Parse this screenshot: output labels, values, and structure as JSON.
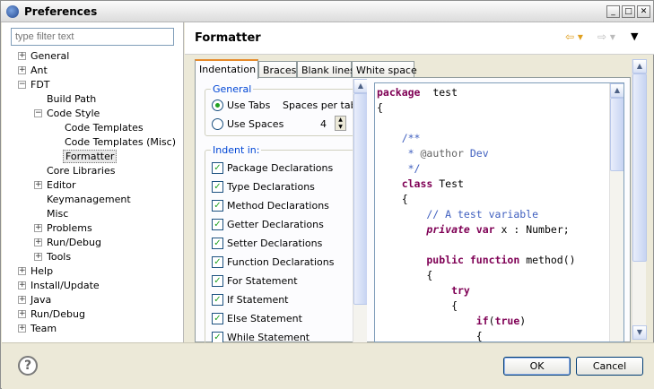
{
  "window": {
    "title": "Preferences",
    "buttons": [
      "_",
      "□",
      "✕"
    ]
  },
  "filter": {
    "placeholder": "type filter text"
  },
  "tree": [
    {
      "label": "General",
      "level": 0,
      "expander": "+"
    },
    {
      "label": "Ant",
      "level": 0,
      "expander": "+"
    },
    {
      "label": "FDT",
      "level": 0,
      "expander": "−"
    },
    {
      "label": "Build Path",
      "level": 1,
      "expander": ""
    },
    {
      "label": "Code Style",
      "level": 1,
      "expander": "−"
    },
    {
      "label": "Code Templates",
      "level": 2,
      "expander": ""
    },
    {
      "label": "Code Templates (Misc)",
      "level": 2,
      "expander": ""
    },
    {
      "label": "Formatter",
      "level": 2,
      "expander": "",
      "selected": true
    },
    {
      "label": "Core Libraries",
      "level": 1,
      "expander": ""
    },
    {
      "label": "Editor",
      "level": 1,
      "expander": "+"
    },
    {
      "label": "Keymanagement",
      "level": 1,
      "expander": ""
    },
    {
      "label": "Misc",
      "level": 1,
      "expander": ""
    },
    {
      "label": "Problems",
      "level": 1,
      "expander": "+"
    },
    {
      "label": "Run/Debug",
      "level": 1,
      "expander": "+"
    },
    {
      "label": "Tools",
      "level": 1,
      "expander": "+"
    },
    {
      "label": "Help",
      "level": 0,
      "expander": "+"
    },
    {
      "label": "Install/Update",
      "level": 0,
      "expander": "+"
    },
    {
      "label": "Java",
      "level": 0,
      "expander": "+"
    },
    {
      "label": "Run/Debug",
      "level": 0,
      "expander": "+"
    },
    {
      "label": "Team",
      "level": 0,
      "expander": "+"
    }
  ],
  "page": {
    "title": "Formatter",
    "back": "⇦ ▾",
    "forward": "⇨ ▾",
    "menu": "▼"
  },
  "tabs": [
    "Indentation",
    "Braces",
    "Blank lines",
    "White space"
  ],
  "general": {
    "label": "General",
    "use_tabs": "Use Tabs",
    "use_spaces": "Use Spaces",
    "spaces_per_tab": "Spaces per tab",
    "spaces_value": "4"
  },
  "indent": {
    "label": "Indent in:",
    "items": [
      "Package Declarations",
      "Type Declarations",
      "Method Declarations",
      "Getter Declarations",
      "Setter Declarations",
      "Function Declarations",
      "For Statement",
      "If Statement",
      "Else Statement",
      "While Statement"
    ]
  },
  "code_lines": [
    [
      [
        "kw",
        "package"
      ],
      [
        "",
        "  test"
      ]
    ],
    [
      [
        "",
        "{"
      ]
    ],
    [
      [
        "",
        ""
      ]
    ],
    [
      [
        "cm",
        "    /**"
      ]
    ],
    [
      [
        "cm",
        "     * "
      ],
      [
        "ann",
        "@author"
      ],
      [
        "cm",
        " Dev"
      ]
    ],
    [
      [
        "cm",
        "     */"
      ]
    ],
    [
      [
        "kw",
        "    class"
      ],
      [
        "",
        " Test"
      ]
    ],
    [
      [
        "",
        "    {"
      ]
    ],
    [
      [
        "cm",
        "        // A test variable"
      ]
    ],
    [
      [
        "kw it",
        "        private"
      ],
      [
        "",
        " "
      ],
      [
        "kw",
        "var"
      ],
      [
        "",
        " x : Number;"
      ]
    ],
    [
      [
        "",
        ""
      ]
    ],
    [
      [
        "kw",
        "        public"
      ],
      [
        "",
        " "
      ],
      [
        "kw",
        "function"
      ],
      [
        "",
        " method()"
      ]
    ],
    [
      [
        "",
        "        {"
      ]
    ],
    [
      [
        "kw",
        "            try"
      ]
    ],
    [
      [
        "",
        "            {"
      ]
    ],
    [
      [
        "kw",
        "                if"
      ],
      [
        "",
        "("
      ],
      [
        "kw",
        "true"
      ],
      [
        "",
        ")"
      ]
    ],
    [
      [
        "",
        "                {"
      ]
    ]
  ],
  "buttons": {
    "help": "?",
    "ok": "OK",
    "cancel": "Cancel"
  },
  "colors": {
    "keyword": "#7f0055",
    "comment": "#3f5fbf",
    "tab_highlight": "#e68b2c",
    "checked": "#21a121"
  }
}
